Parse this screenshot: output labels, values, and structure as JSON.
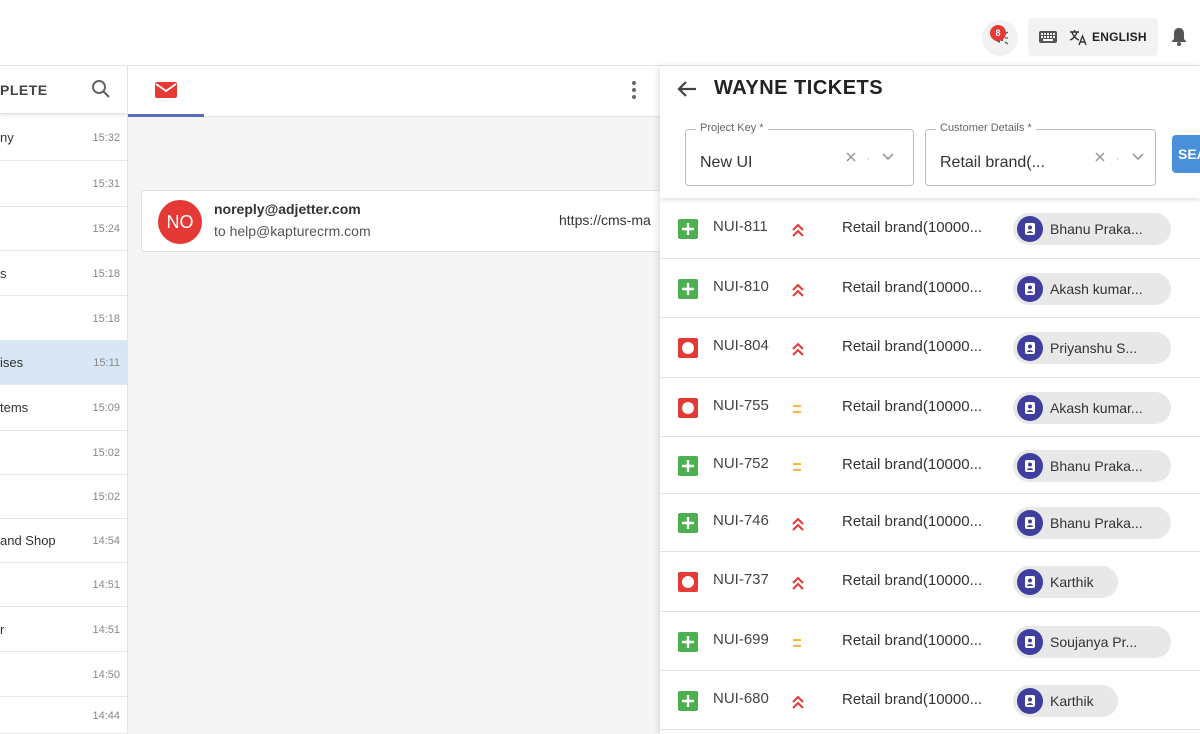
{
  "topbar": {
    "notification_count": "8",
    "language_label": "ENGLISH"
  },
  "left_list": {
    "title": "PLETE",
    "items": [
      {
        "name": "ny",
        "time": "15:32",
        "active": false
      },
      {
        "name": "",
        "time": "15:31",
        "active": false
      },
      {
        "name": "",
        "time": "15:24",
        "active": false
      },
      {
        "name": "s",
        "time": "15:18",
        "active": false
      },
      {
        "name": "",
        "time": "15:18",
        "active": false
      },
      {
        "name": "ises",
        "time": "15:11",
        "active": true
      },
      {
        "name": "tems",
        "time": "15:09",
        "active": false
      },
      {
        "name": "",
        "time": "15:02",
        "active": false
      },
      {
        "name": "",
        "time": "15:02",
        "active": false
      },
      {
        "name": "and Shop",
        "time": "14:54",
        "active": false
      },
      {
        "name": "",
        "time": "14:51",
        "active": false
      },
      {
        "name": "r",
        "time": "14:51",
        "active": false
      },
      {
        "name": "",
        "time": "14:50",
        "active": false
      },
      {
        "name": "",
        "time": "14:44",
        "active": false
      }
    ]
  },
  "email": {
    "avatar_initials": "NO",
    "from": "noreply@adjetter.com",
    "to": "to help@kapturecrm.com",
    "link_text": "https://cms-ma"
  },
  "panel": {
    "title": "WAYNE TICKETS",
    "project_key": {
      "label": "Project Key *",
      "value": "New UI"
    },
    "customer_details": {
      "label": "Customer Details *",
      "value": "Retail brand(..."
    },
    "search_label": "SEARCH",
    "colors": {
      "story": "#4caf50",
      "bug": "#e53935",
      "priority_high": "#e53935",
      "priority_medium": "#f5b942",
      "avatar": "#3f3d9e"
    },
    "tickets": [
      {
        "key": "NUI-811",
        "type": "story",
        "priority": "high",
        "customer": "Retail brand(10000...",
        "assignee": "Bhanu Praka..."
      },
      {
        "key": "NUI-810",
        "type": "story",
        "priority": "high",
        "customer": "Retail brand(10000...",
        "assignee": "Akash kumar..."
      },
      {
        "key": "NUI-804",
        "type": "bug",
        "priority": "high",
        "customer": "Retail brand(10000...",
        "assignee": "Priyanshu S..."
      },
      {
        "key": "NUI-755",
        "type": "bug",
        "priority": "medium",
        "customer": "Retail brand(10000...",
        "assignee": "Akash kumar..."
      },
      {
        "key": "NUI-752",
        "type": "story",
        "priority": "medium",
        "customer": "Retail brand(10000...",
        "assignee": "Bhanu Praka..."
      },
      {
        "key": "NUI-746",
        "type": "story",
        "priority": "high",
        "customer": "Retail brand(10000...",
        "assignee": "Bhanu Praka..."
      },
      {
        "key": "NUI-737",
        "type": "bug",
        "priority": "high",
        "customer": "Retail brand(10000...",
        "assignee": "Karthik"
      },
      {
        "key": "NUI-699",
        "type": "story",
        "priority": "medium",
        "customer": "Retail brand(10000...",
        "assignee": "Soujanya Pr..."
      },
      {
        "key": "NUI-680",
        "type": "story",
        "priority": "high",
        "customer": "Retail brand(10000...",
        "assignee": "Karthik"
      }
    ]
  }
}
